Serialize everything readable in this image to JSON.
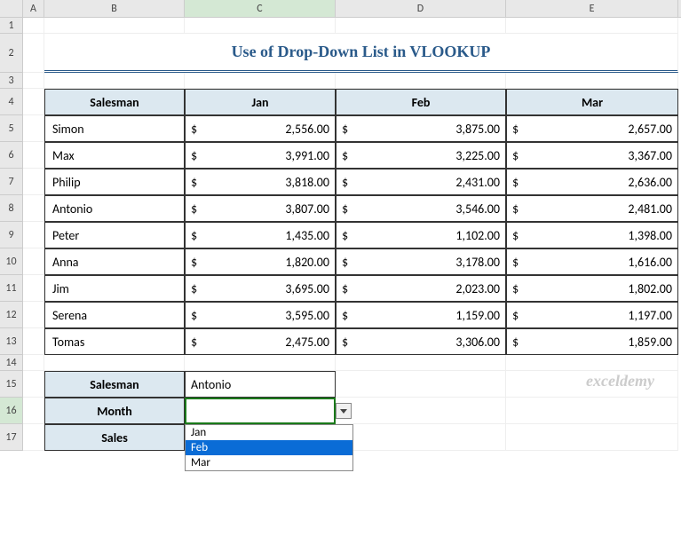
{
  "columns": [
    "A",
    "B",
    "C",
    "D",
    "E"
  ],
  "title": "Use of Drop-Down List in VLOOKUP",
  "table": {
    "headers": [
      "Salesman",
      "Jan",
      "Feb",
      "Mar"
    ],
    "rows": [
      {
        "name": "Simon",
        "jan": "2,556.00",
        "feb": "3,875.00",
        "mar": "2,657.00"
      },
      {
        "name": "Max",
        "jan": "3,991.00",
        "feb": "3,225.00",
        "mar": "3,367.00"
      },
      {
        "name": "Philip",
        "jan": "3,818.00",
        "feb": "2,431.00",
        "mar": "2,636.00"
      },
      {
        "name": "Antonio",
        "jan": "3,807.00",
        "feb": "3,546.00",
        "mar": "2,481.00"
      },
      {
        "name": "Peter",
        "jan": "1,435.00",
        "feb": "1,102.00",
        "mar": "1,398.00"
      },
      {
        "name": "Anna",
        "jan": "1,820.00",
        "feb": "3,178.00",
        "mar": "1,616.00"
      },
      {
        "name": "Jim",
        "jan": "3,695.00",
        "feb": "2,023.00",
        "mar": "1,802.00"
      },
      {
        "name": "Serena",
        "jan": "3,595.00",
        "feb": "1,159.00",
        "mar": "1,197.00"
      },
      {
        "name": "Tomas",
        "jan": "2,475.00",
        "feb": "3,306.00",
        "mar": "1,859.00"
      }
    ]
  },
  "lookup": {
    "labels": {
      "salesman": "Salesman",
      "month": "Month",
      "sales": "Sales"
    },
    "salesman_value": "Antonio",
    "month_value": "",
    "sales_value": ""
  },
  "dropdown": {
    "items": [
      "Jan",
      "Feb",
      "Mar"
    ],
    "selected": "Feb"
  },
  "currency_symbol": "$",
  "watermark": "exceldemy",
  "active_cell": "C16",
  "row_numbers": [
    1,
    2,
    3,
    4,
    5,
    6,
    7,
    8,
    9,
    10,
    11,
    12,
    13,
    14,
    15,
    16,
    17
  ]
}
